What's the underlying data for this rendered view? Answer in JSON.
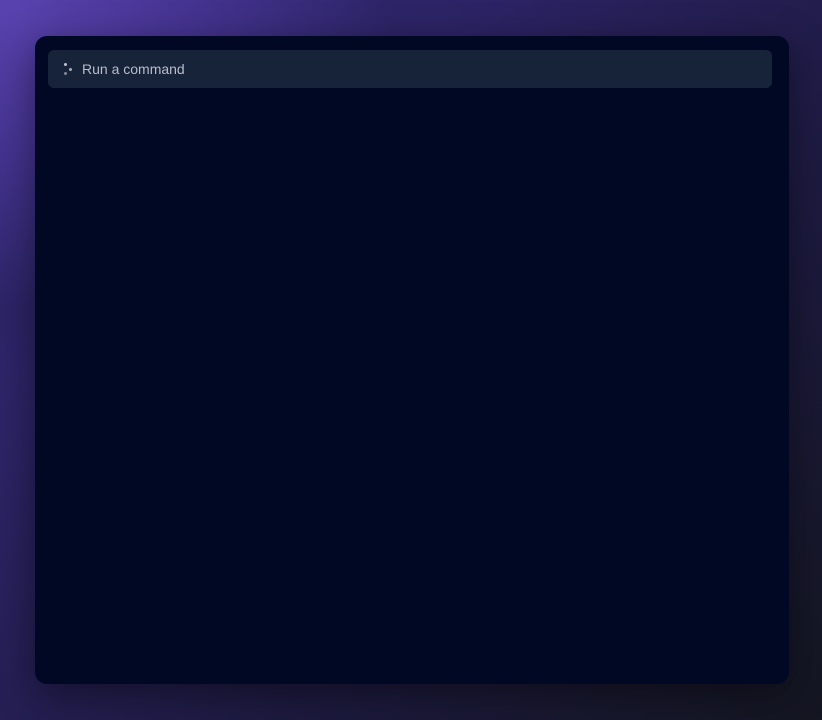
{
  "command_bar": {
    "icon": "spinner-icon",
    "value": "",
    "placeholder": "Run a command"
  },
  "colors": {
    "window_background": "#000823",
    "command_bar_background": "#172339",
    "text": "#c9ced8",
    "backdrop_accent": "#5a43b0"
  }
}
